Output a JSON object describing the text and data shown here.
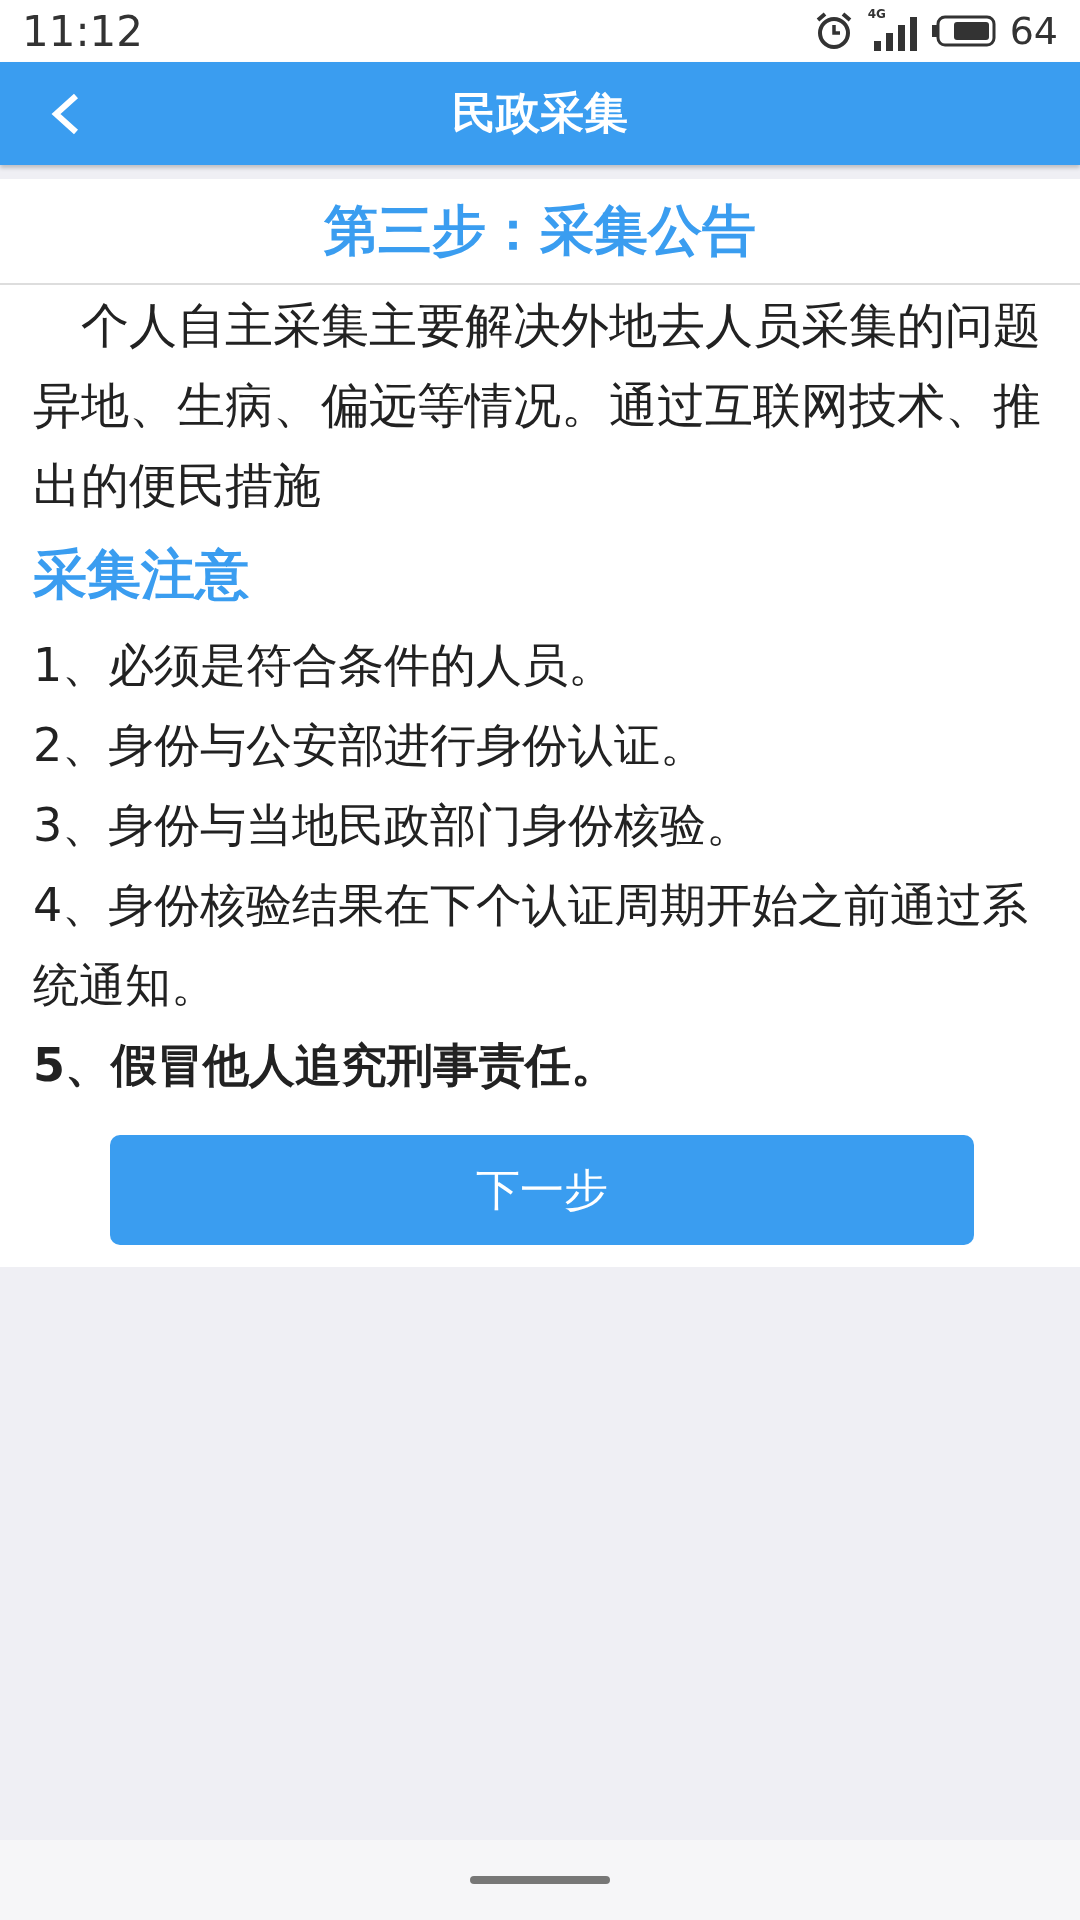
{
  "status_bar": {
    "time": "11:12",
    "network": "4G",
    "battery": "64"
  },
  "header": {
    "title": "民政采集"
  },
  "step_title": "第三步：采集公告",
  "intro": "个人自主采集主要解决外地去人员采集的问题异地、生病、偏远等情况。通过互联网技术、推出的便民措施",
  "notes_heading": "采集注意",
  "notes": [
    {
      "text": "1、必须是符合条件的人员。",
      "bold": false
    },
    {
      "text": "2、身份与公安部进行身份认证。",
      "bold": false
    },
    {
      "text": "3、身份与当地民政部门身份核验。",
      "bold": false
    },
    {
      "text": "4、身份核验结果在下个认证周期开始之前通过系统通知。",
      "bold": false
    },
    {
      "text": "5、假冒他人追究刑事责任。",
      "bold": true
    }
  ],
  "next_button": "下一步"
}
